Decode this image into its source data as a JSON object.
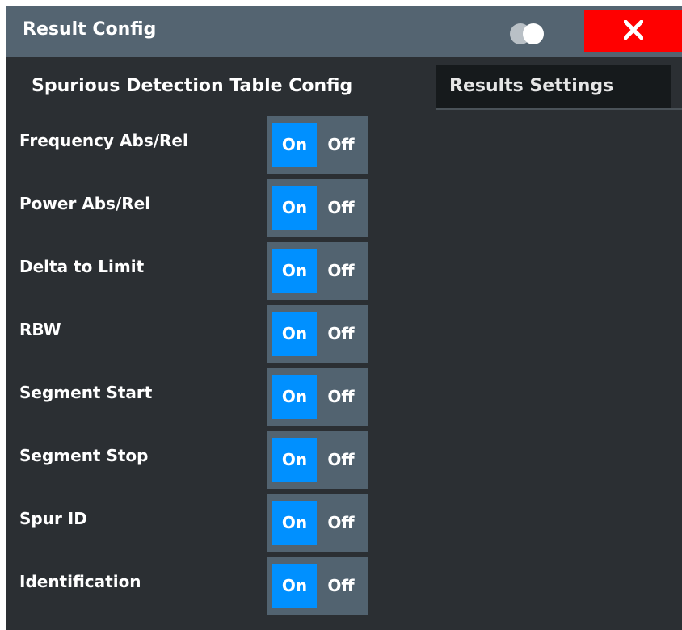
{
  "dialog": {
    "title": "Result Config",
    "close_icon": "close-icon",
    "toggle_icon": "dual-circle-toggle-icon"
  },
  "tabs": [
    {
      "label": "Spurious Detection Table Config",
      "active": true
    },
    {
      "label": "Results Settings",
      "active": false
    }
  ],
  "rows": [
    {
      "label": "Frequency Abs/Rel",
      "on_label": "On",
      "off_label": "Off",
      "state": "On"
    },
    {
      "label": "Power Abs/Rel",
      "on_label": "On",
      "off_label": "Off",
      "state": "On"
    },
    {
      "label": "Delta to Limit",
      "on_label": "On",
      "off_label": "Off",
      "state": "On"
    },
    {
      "label": "RBW",
      "on_label": "On",
      "off_label": "Off",
      "state": "On"
    },
    {
      "label": "Segment Start",
      "on_label": "On",
      "off_label": "Off",
      "state": "On"
    },
    {
      "label": "Segment Stop",
      "on_label": "On",
      "off_label": "Off",
      "state": "On"
    },
    {
      "label": "Spur ID",
      "on_label": "On",
      "off_label": "Off",
      "state": "On"
    },
    {
      "label": "Identification",
      "on_label": "On",
      "off_label": "Off",
      "state": "On"
    }
  ],
  "colors": {
    "titlebar": "#546471",
    "background": "#2b2f33",
    "close": "#ff0000",
    "on_active": "#0090ff",
    "switch_track": "#526370",
    "inactive_tab": "#161a1c"
  }
}
